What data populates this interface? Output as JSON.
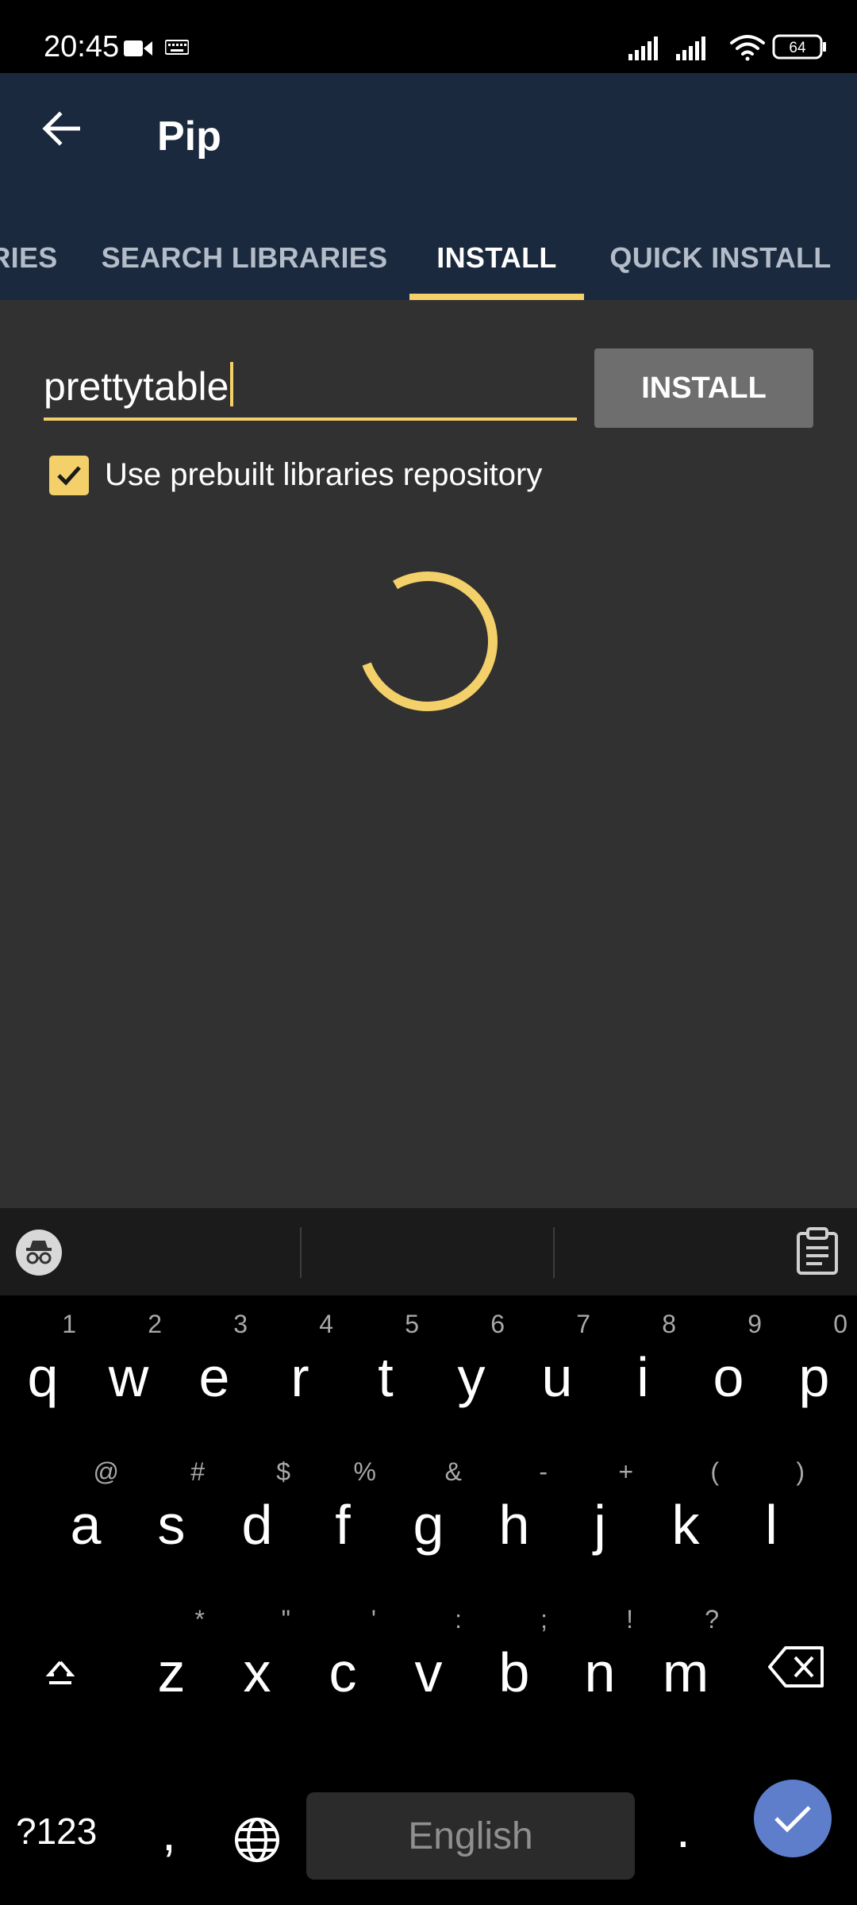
{
  "status_bar": {
    "time": "20:45",
    "battery": "64"
  },
  "app_bar": {
    "title": "Pip"
  },
  "tabs": [
    {
      "label": "RIES",
      "active": false
    },
    {
      "label": "SEARCH LIBRARIES",
      "active": false
    },
    {
      "label": "INSTALL",
      "active": true
    },
    {
      "label": "QUICK INSTALL",
      "active": false
    }
  ],
  "install_form": {
    "package_value": "prettytable",
    "install_button_label": "INSTALL",
    "prebuilt_checkbox_label": "Use prebuilt libraries repository",
    "prebuilt_checked": true
  },
  "keyboard": {
    "row1": [
      {
        "key": "q",
        "hint": "1"
      },
      {
        "key": "w",
        "hint": "2"
      },
      {
        "key": "e",
        "hint": "3"
      },
      {
        "key": "r",
        "hint": "4"
      },
      {
        "key": "t",
        "hint": "5"
      },
      {
        "key": "y",
        "hint": "6"
      },
      {
        "key": "u",
        "hint": "7"
      },
      {
        "key": "i",
        "hint": "8"
      },
      {
        "key": "o",
        "hint": "9"
      },
      {
        "key": "p",
        "hint": "0"
      }
    ],
    "row2": [
      {
        "key": "a",
        "hint": "@"
      },
      {
        "key": "s",
        "hint": "#"
      },
      {
        "key": "d",
        "hint": "$"
      },
      {
        "key": "f",
        "hint": "%"
      },
      {
        "key": "g",
        "hint": "&"
      },
      {
        "key": "h",
        "hint": "-"
      },
      {
        "key": "j",
        "hint": "+"
      },
      {
        "key": "k",
        "hint": "("
      },
      {
        "key": "l",
        "hint": ")"
      }
    ],
    "row3": [
      {
        "key": "z",
        "hint": "*"
      },
      {
        "key": "x",
        "hint": "\""
      },
      {
        "key": "c",
        "hint": "'"
      },
      {
        "key": "v",
        "hint": ":"
      },
      {
        "key": "b",
        "hint": ";"
      },
      {
        "key": "n",
        "hint": "!"
      },
      {
        "key": "m",
        "hint": "?"
      }
    ],
    "symbols_label": "?123",
    "comma_label": ",",
    "space_label": "English",
    "period_label": "."
  },
  "colors": {
    "accent": "#f3d069",
    "app_bar": "#1a293d",
    "content_bg": "#313131",
    "enter_key": "#5e7ecc"
  }
}
